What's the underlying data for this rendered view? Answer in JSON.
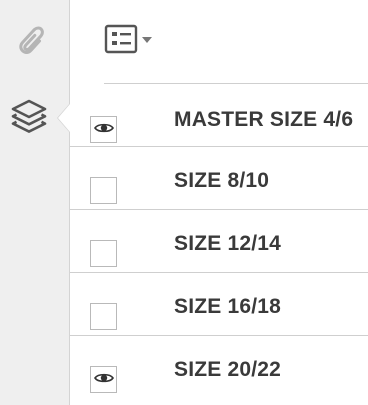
{
  "rail": {
    "items": [
      {
        "icon": "paperclip-icon"
      },
      {
        "icon": "layers-icon"
      }
    ]
  },
  "panel": {
    "options_icon": "layer-options-icon"
  },
  "layers": [
    {
      "name": "MASTER SIZE 4/6",
      "visible": true
    },
    {
      "name": "SIZE 8/10",
      "visible": false
    },
    {
      "name": "SIZE 12/14",
      "visible": false
    },
    {
      "name": "SIZE 16/18",
      "visible": false
    },
    {
      "name": "SIZE 20/22",
      "visible": true
    }
  ],
  "colors": {
    "rail_bg": "#efefef",
    "icon_gray": "#b5b5b5",
    "icon_dark": "#555555",
    "text": "#3a3a3a",
    "divider": "#cfcfcf"
  }
}
